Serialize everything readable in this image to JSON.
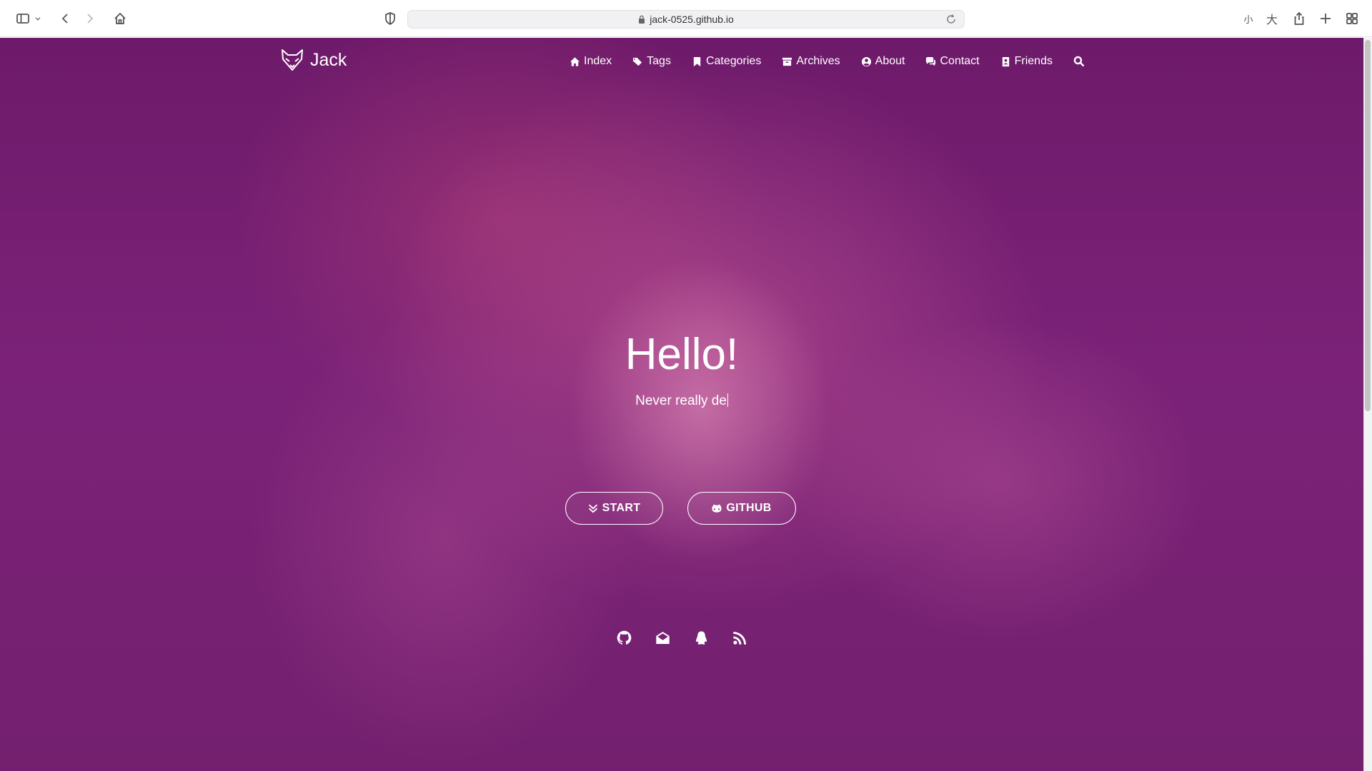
{
  "browser": {
    "url": "jack-0525.github.io"
  },
  "site": {
    "brand": "Jack",
    "nav": [
      {
        "label": "Index",
        "icon": "home-icon"
      },
      {
        "label": "Tags",
        "icon": "tags-icon"
      },
      {
        "label": "Categories",
        "icon": "bookmark-icon"
      },
      {
        "label": "Archives",
        "icon": "archive-icon"
      },
      {
        "label": "About",
        "icon": "user-circle-icon"
      },
      {
        "label": "Contact",
        "icon": "comments-icon"
      },
      {
        "label": "Friends",
        "icon": "address-book-icon"
      }
    ]
  },
  "hero": {
    "title": "Hello!",
    "subtitle": "Never really de",
    "start_label": "START",
    "github_label": "GITHUB"
  },
  "social": [
    "github-icon",
    "email-icon",
    "qq-icon",
    "rss-icon"
  ],
  "colors": {
    "overlay": "#7b2278",
    "text": "#ffffff"
  }
}
